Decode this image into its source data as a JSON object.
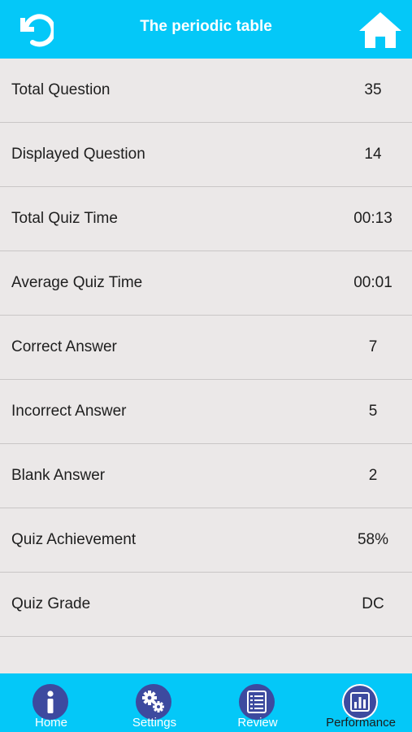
{
  "header": {
    "title": "The periodic table",
    "back_icon": "refresh-back-icon",
    "home_icon": "home-icon"
  },
  "colors": {
    "accent": "#04c8f8",
    "background": "#ebe8e8",
    "tab_icon_circle": "#3d4a9f"
  },
  "stats": [
    {
      "label": "Total Question",
      "value": "35"
    },
    {
      "label": "Displayed Question",
      "value": "14"
    },
    {
      "label": "Total Quiz Time",
      "value": "00:13"
    },
    {
      "label": "Average Quiz Time",
      "value": "00:01"
    },
    {
      "label": "Correct Answer",
      "value": "7"
    },
    {
      "label": "Incorrect Answer",
      "value": "5"
    },
    {
      "label": "Blank Answer",
      "value": "2"
    },
    {
      "label": "Quiz Achievement",
      "value": "58%"
    },
    {
      "label": "Quiz Grade",
      "value": "DC"
    }
  ],
  "tabs": [
    {
      "label": "Home",
      "icon": "info-icon"
    },
    {
      "label": "Settings",
      "icon": "gears-icon"
    },
    {
      "label": "Review",
      "icon": "list-icon"
    },
    {
      "label": "Performance",
      "icon": "bar-chart-icon",
      "active": true
    }
  ]
}
